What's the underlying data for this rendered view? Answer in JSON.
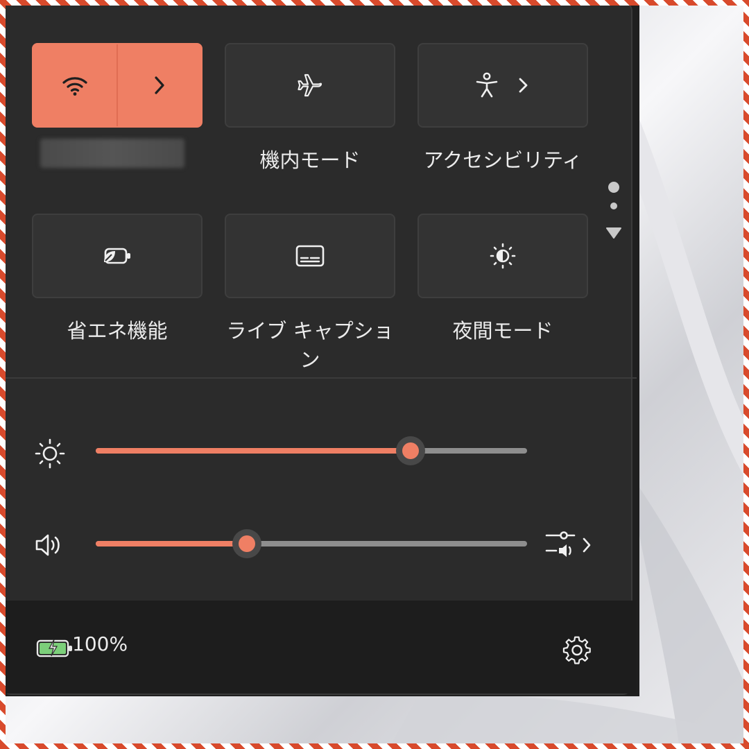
{
  "tiles": [
    {
      "label": "",
      "icon": "wifi-icon",
      "active": true
    },
    {
      "label": "機内モード",
      "icon": "airplane-icon",
      "active": false
    },
    {
      "label": "アクセシビリティ",
      "icon": "accessibility-icon",
      "active": false
    },
    {
      "label": "省エネ機能",
      "icon": "battery-saver-icon",
      "active": false
    },
    {
      "label": "ライブ キャプション",
      "icon": "live-caption-icon",
      "active": false
    },
    {
      "label": "夜間モード",
      "icon": "night-light-icon",
      "active": false
    }
  ],
  "sliders": {
    "brightness": {
      "icon": "brightness-icon",
      "value": 0.73
    },
    "volume": {
      "icon": "speaker-icon",
      "value": 0.35
    }
  },
  "footer": {
    "battery_icon": "battery-charging-icon",
    "battery_percent": "100%",
    "settings_icon": "gear-icon"
  },
  "colors": {
    "accent": "#ef7f64",
    "panel": "#2b2b2b",
    "tile": "#333333",
    "battery": "#7ccf7a"
  }
}
